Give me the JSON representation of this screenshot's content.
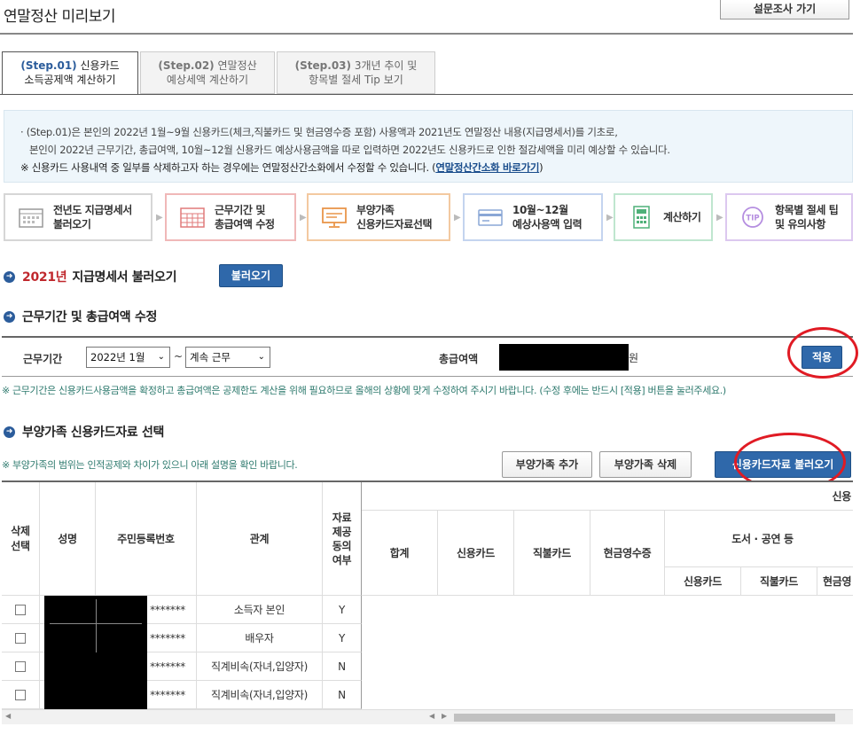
{
  "header": {
    "title": "연말정산 미리보기",
    "survey_button": "설문조사 가기"
  },
  "tabs": [
    {
      "step": "(Step.01)",
      "label1": "신용카드",
      "label2": "소득공제액 계산하기"
    },
    {
      "step": "(Step.02)",
      "label1": "연말정산",
      "label2": "예상세액 계산하기"
    },
    {
      "step": "(Step.03)",
      "label1": "3개년 추이 및",
      "label2": "항목별 절세 Tip 보기"
    }
  ],
  "notice": {
    "line1": "· (Step.01)은 본인의 2022년 1월~9월 신용카드(체크,직불카드 및 현금영수증 포함) 사용액과 2021년도 연말정산 내용(지급명세서)를 기초로,",
    "line2": "본인이 2022년 근무기간, 총급여액, 10월~12월 신용카드 예상사용금액을 따로 입력하면 2022년도 신용카드로 인한 절감세액을 미리 예상할 수 있습니다.",
    "line3_prefix": "※ 신용카드 사용내역 중 일부를 삭제하고자 하는 경우에는 연말정산간소화에서 수정할 수 있습니다. (",
    "line3_link": "연말정산간소화 바로가기",
    "line3_suffix": ")"
  },
  "steps": [
    {
      "l1": "전년도 지급명세서",
      "l2": "불러오기",
      "icon": "calendar-icon",
      "color": "#d6d6d6"
    },
    {
      "l1": "근무기간 및",
      "l2": "총급여액 수정",
      "icon": "calendar-grid-icon",
      "color": "#f0b8b8"
    },
    {
      "l1": "부양가족",
      "l2": "신용카드자료선택",
      "icon": "monitor-icon",
      "color": "#f3c9a0"
    },
    {
      "l1": "10월~12월",
      "l2": "예상사용액 입력",
      "icon": "card-icon",
      "color": "#c4d4ef"
    },
    {
      "l1": "계산하기",
      "l2": "",
      "icon": "calculator-icon",
      "color": "#bfe6cf"
    },
    {
      "l1": "항목별 절세 팁",
      "l2": "및 유의사항",
      "icon": "tip-icon",
      "color": "#dcc8ef"
    }
  ],
  "section1": {
    "year": "2021년",
    "title": "지급명세서 불러오기",
    "button": "불러오기"
  },
  "section2": {
    "title": "근무기간 및 총급여액 수정",
    "work_period_label": "근무기간",
    "start_select": "2022년 1월",
    "tilde": "~",
    "end_select": "계속 근무",
    "salary_label": "총급여액",
    "salary_unit": "원",
    "apply_button": "적용",
    "hint": "※ 근무기간은 신용카드사용금액을 확정하고 총급여액은 공제한도 계산을 위해 필요하므로 올해의 상황에 맞게 수정하여 주시기 바랍니다. (수정 후에는 반드시 [적용] 버튼을 눌러주세요.)"
  },
  "section3": {
    "title": "부양가족 신용카드자료 선택",
    "hint": "※ 부양가족의 범위는 인적공제와 차이가 있으니 아래 설명을 확인 바랍니다.",
    "add_button": "부양가족 추가",
    "delete_button": "부양가족 삭제",
    "load_button": "신용카드자료 불러오기"
  },
  "table": {
    "headers": {
      "select": "삭제\n선택",
      "name": "성명",
      "rrn": "주민등록번호",
      "relation": "관계",
      "consent": "자료\n제공\n동의\n여부",
      "group_top": "신용",
      "total": "합계",
      "credit": "신용카드",
      "debit": "직불카드",
      "cash": "현금영수증",
      "books_group": "도서 · 공연 등",
      "books_credit": "신용카드",
      "books_debit": "직불카드",
      "books_cash": "현금영"
    },
    "rows": [
      {
        "rrn": "*******",
        "relation": "소득자 본인",
        "consent": "Y"
      },
      {
        "rrn": "*******",
        "relation": "배우자",
        "consent": "Y"
      },
      {
        "rrn": "*******",
        "relation": "직계비속(자녀,입양자)",
        "consent": "N"
      },
      {
        "rrn": "*******",
        "relation": "직계비속(자녀,입양자)",
        "consent": "N"
      }
    ]
  }
}
